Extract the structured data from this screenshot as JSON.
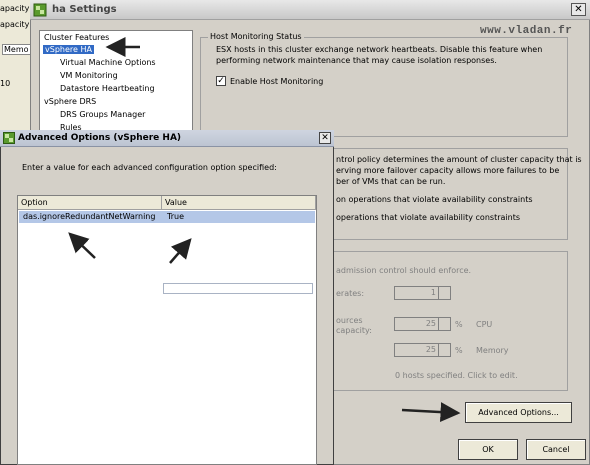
{
  "background_app": {
    "lines": [
      "apacity",
      "apacity",
      "Memo",
      "10"
    ]
  },
  "window": {
    "title": "ha Settings",
    "close_glyph": "✕"
  },
  "watermark": "www.vladan.fr",
  "nav": {
    "items": [
      {
        "label": "Cluster Features",
        "indent": 0,
        "selected": false
      },
      {
        "label": "vSphere HA",
        "indent": 0,
        "selected": true
      },
      {
        "label": "Virtual Machine Options",
        "indent": 1,
        "selected": false
      },
      {
        "label": "VM Monitoring",
        "indent": 1,
        "selected": false
      },
      {
        "label": "Datastore Heartbeating",
        "indent": 1,
        "selected": false
      },
      {
        "label": "vSphere DRS",
        "indent": 0,
        "selected": false
      },
      {
        "label": "DRS Groups Manager",
        "indent": 1,
        "selected": false
      },
      {
        "label": "Rules",
        "indent": 1,
        "selected": false
      }
    ]
  },
  "host_monitoring": {
    "title": "Host Monitoring Status",
    "description_line1": "ESX hosts in this cluster exchange network heartbeats. Disable this feature when",
    "description_line2": "performing network maintenance that may cause isolation responses.",
    "enable_label": "Enable Host Monitoring",
    "enable_checked": true
  },
  "admission_control": {
    "desc_line1": "ntrol policy determines the amount of cluster capacity that is",
    "desc_line2": "erving more failover capacity allows more failures to be",
    "desc_line3": "ber of VMs that can be run.",
    "option1": "on operations that violate availability constraints",
    "option2": "operations that violate availability constraints"
  },
  "policy": {
    "header": "admission control should enforce.",
    "tolerates_label": "erates:",
    "tolerates_value": "1",
    "resources_label1": "ources",
    "resources_label2": "capacity:",
    "cpu_value": "25",
    "cpu_unit": "%",
    "cpu_label": "CPU",
    "memory_value": "25",
    "memory_unit": "%",
    "memory_label": "Memory",
    "hosts_text": "0 hosts specified. Click to edit."
  },
  "buttons": {
    "advanced": "Advanced Options...",
    "ok": "OK",
    "cancel": "Cancel"
  },
  "advanced_dialog": {
    "title": "Advanced Options (vSphere HA)",
    "close_glyph": "✕",
    "prompt": "Enter a value for each advanced configuration option specified:",
    "columns": [
      "Option",
      "Value"
    ],
    "rows": [
      {
        "option": "das.ignoreRedundantNetWarning",
        "value": "True"
      }
    ]
  }
}
